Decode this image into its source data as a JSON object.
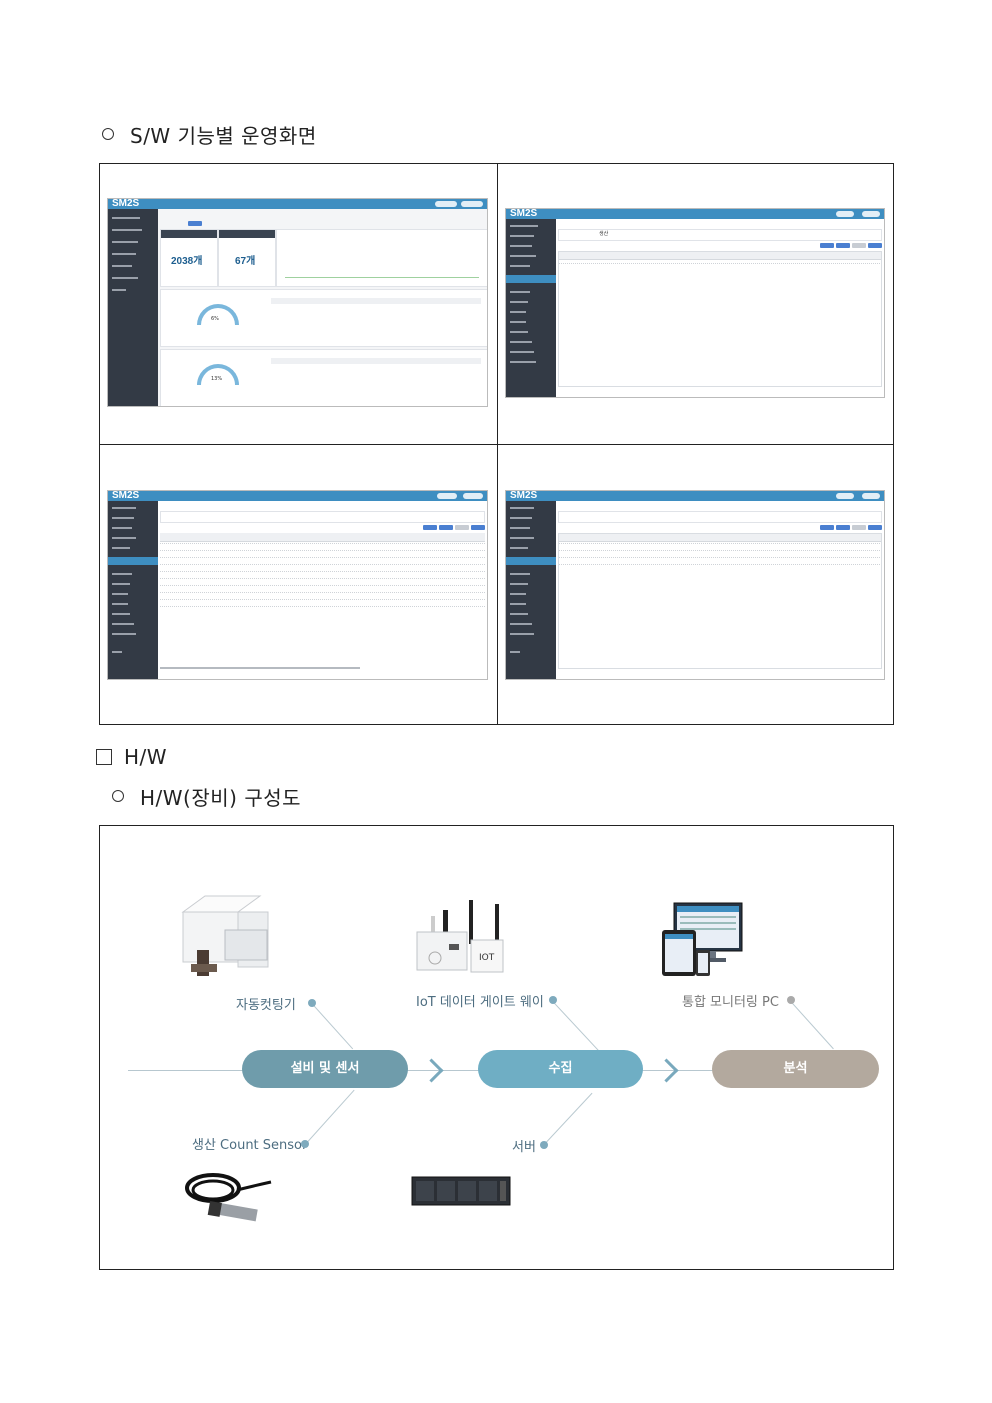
{
  "sw_section": {
    "title": "S/W 기능별 운영화면"
  },
  "hw_section": {
    "title": "H/W",
    "subtitle": "H/W(장비) 구성도"
  },
  "screenshots": {
    "logo": "SM2S",
    "dashboard": {
      "count1": "2038개",
      "count2": "67개",
      "gauge1": "6%",
      "gauge2": "13%"
    },
    "list_tab_value": "생산"
  },
  "diagram": {
    "stages": [
      {
        "label": "설비 및 센서",
        "color": "#6f9cab"
      },
      {
        "label": "수집",
        "color": "#6faec4"
      },
      {
        "label": "분석",
        "color": "#b3a99e"
      }
    ],
    "devices": {
      "cutter": "자동컷팅기",
      "gateway": "IoT 데이터 게이트 웨이",
      "monitor": "통합 모니터링 PC",
      "sensor": "생산 Count Sensor",
      "server": "서버"
    },
    "gateway_badge": "IOT"
  }
}
